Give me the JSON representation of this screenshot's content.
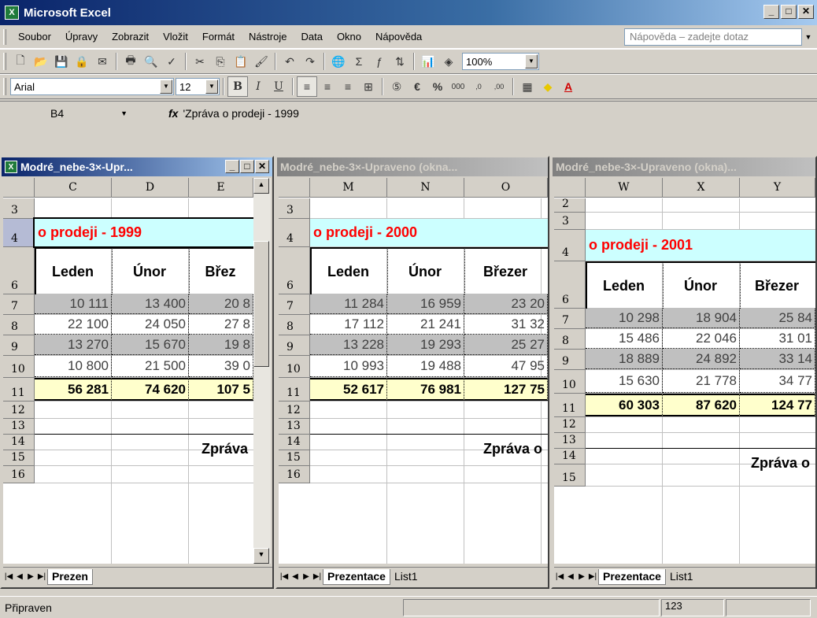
{
  "app": {
    "title": "Microsoft Excel"
  },
  "menu": {
    "items": [
      "Soubor",
      "Úpravy",
      "Zobrazit",
      "Vložit",
      "Formát",
      "Nástroje",
      "Data",
      "Okno",
      "Nápověda"
    ],
    "help_placeholder": "Nápověda – zadejte dotaz"
  },
  "toolbar": {
    "zoom": "100%",
    "font": "Arial",
    "font_size": "12",
    "bold": "B",
    "italic": "I",
    "underline": "U",
    "currency": "€",
    "percent": "%",
    "thousands": "000",
    "inc_dec": ",00→,0",
    "dec_dec": ",0→,00"
  },
  "formula": {
    "cell_ref": "B4",
    "fx": "fx",
    "value": "'Zpráva o prodeji - 1999"
  },
  "windows": [
    {
      "title": "Modré_nebe-3×-Upr...",
      "active": true,
      "columns": [
        "C",
        "D",
        "E"
      ],
      "rows": [
        "3",
        "4",
        "6",
        "7",
        "8",
        "9",
        "10",
        "11",
        "12",
        "13",
        "14",
        "15",
        "16"
      ],
      "heading": "o prodeji - 1999",
      "months": [
        "Leden",
        "Únor",
        "Břez"
      ],
      "data": [
        [
          "10 111",
          "13 400",
          "20 8"
        ],
        [
          "22 100",
          "24 050",
          "27 8"
        ],
        [
          "13 270",
          "15 670",
          "19 8"
        ],
        [
          "10 800",
          "21 500",
          "39 0"
        ]
      ],
      "totals": [
        "56 281",
        "74 620",
        "107 5"
      ],
      "footer_text": "Zpráva",
      "tabs": [
        "Prezen"
      ]
    },
    {
      "title": "Modré_nebe-3×-Upraveno (okna...",
      "active": false,
      "columns": [
        "M",
        "N",
        "O"
      ],
      "rows": [
        "3",
        "4",
        "6",
        "7",
        "8",
        "9",
        "10",
        "11",
        "12",
        "13",
        "14",
        "15",
        "16"
      ],
      "heading": "o prodeji - 2000",
      "months": [
        "Leden",
        "Únor",
        "Březer"
      ],
      "data": [
        [
          "11 284",
          "16 959",
          "23 20"
        ],
        [
          "17 112",
          "21 241",
          "31 32"
        ],
        [
          "13 228",
          "19 293",
          "25 27"
        ],
        [
          "10 993",
          "19 488",
          "47 95"
        ]
      ],
      "totals": [
        "52 617",
        "76 981",
        "127 75"
      ],
      "footer_text": "Zpráva o",
      "tabs": [
        "Prezentace",
        "List1"
      ]
    },
    {
      "title": "Modré_nebe-3×-Upraveno (okna)...",
      "active": false,
      "columns": [
        "W",
        "X",
        "Y"
      ],
      "rows": [
        "2",
        "3",
        "4",
        "6",
        "7",
        "8",
        "9",
        "10",
        "11",
        "12",
        "13",
        "14",
        "15"
      ],
      "heading": "o prodeji - 2001",
      "months": [
        "Leden",
        "Únor",
        "Březer"
      ],
      "data": [
        [
          "10 298",
          "18 904",
          "25 84"
        ],
        [
          "15 486",
          "22 046",
          "31 01"
        ],
        [
          "18 889",
          "24 892",
          "33 14"
        ],
        [
          "15 630",
          "21 778",
          "34 77"
        ]
      ],
      "totals": [
        "60 303",
        "87 620",
        "124 77"
      ],
      "footer_text": "Zpráva o",
      "tabs": [
        "Prezentace",
        "List1"
      ]
    }
  ],
  "status": {
    "text": "Připraven",
    "count": "123"
  },
  "colors": {
    "heading_bg": "#ccffff",
    "heading_fg": "#ff0000",
    "total_bg": "#ffffcc",
    "data_bg": "#c0c0c0"
  }
}
